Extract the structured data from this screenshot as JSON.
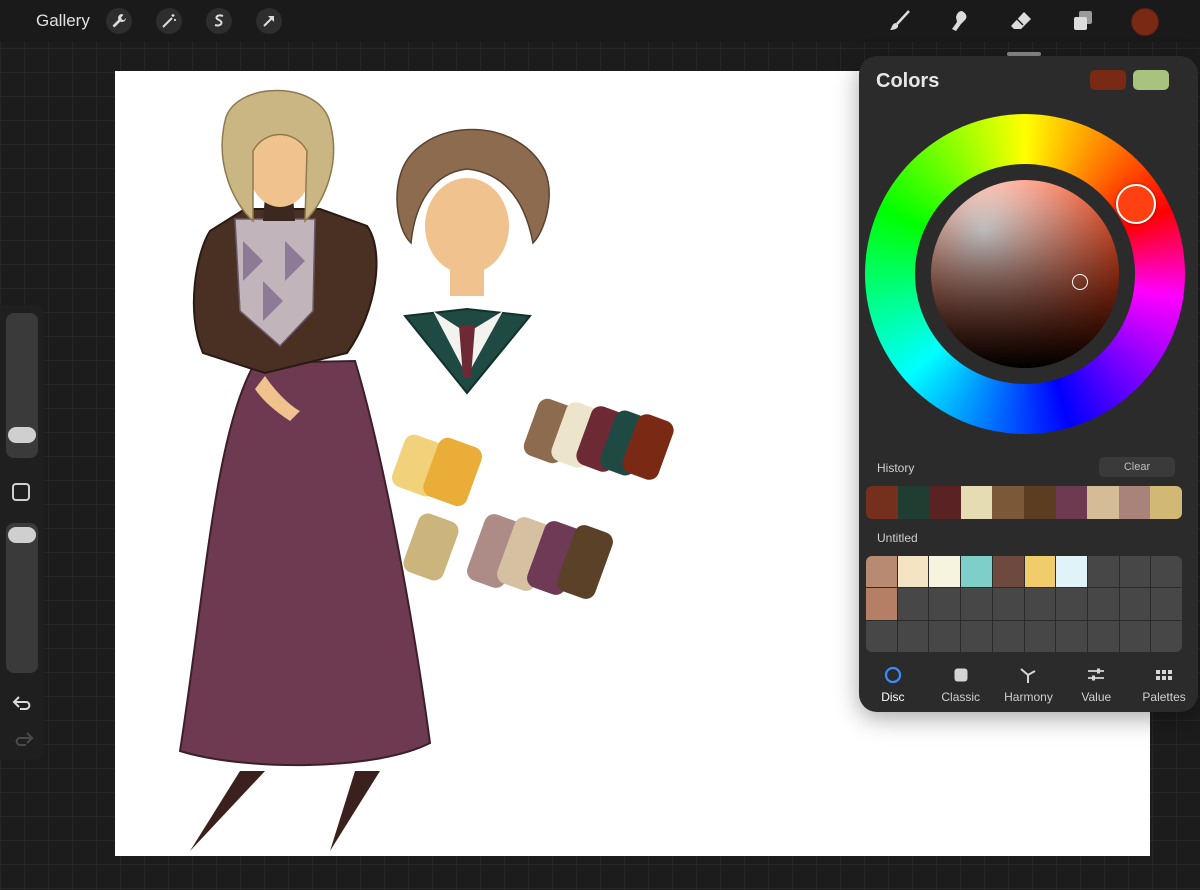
{
  "topbar": {
    "gallery_label": "Gallery",
    "left_tools": [
      "wrench-icon",
      "magic-wand-icon",
      "selection-icon",
      "transform-icon"
    ],
    "right_tools": [
      "brush-icon",
      "smudge-icon",
      "eraser-icon",
      "layers-icon"
    ],
    "current_color": "#7a2a14"
  },
  "colors_panel": {
    "title": "Colors",
    "primary_color": "#7a2a14",
    "secondary_color": "#a9c27e",
    "history_label": "History",
    "clear_label": "Clear",
    "history": [
      "#74301d",
      "#1f3d31",
      "#5b2224",
      "#e5dcb3",
      "#7a5838",
      "#5b3e22",
      "#6d3a52",
      "#d3bc96",
      "#a9837a",
      "#d1b875"
    ],
    "palette_name": "Untitled",
    "palette": [
      "#b98a72",
      "#f5e4c4",
      "#f6f3df",
      "#7ecfc9",
      "#6e4a3e",
      "#f1cc6b",
      "#dff3f8",
      "#b57f66"
    ],
    "tabs": [
      {
        "label": "Disc",
        "icon": "disc-icon",
        "active": true
      },
      {
        "label": "Classic",
        "icon": "classic-icon",
        "active": false
      },
      {
        "label": "Harmony",
        "icon": "harmony-icon",
        "active": false
      },
      {
        "label": "Value",
        "icon": "value-sliders-icon",
        "active": false
      },
      {
        "label": "Palettes",
        "icon": "palettes-grid-icon",
        "active": false
      }
    ]
  },
  "canvas_swatches": [
    "#f1d27b",
    "#e9ad38",
    "#8c6b4e",
    "#ece5cc",
    "#6d2a34",
    "#1f4a44",
    "#7a2a14",
    "#cbb57c",
    "#ad8c87",
    "#d5c0a1",
    "#6e3a56",
    "#5b4128"
  ]
}
